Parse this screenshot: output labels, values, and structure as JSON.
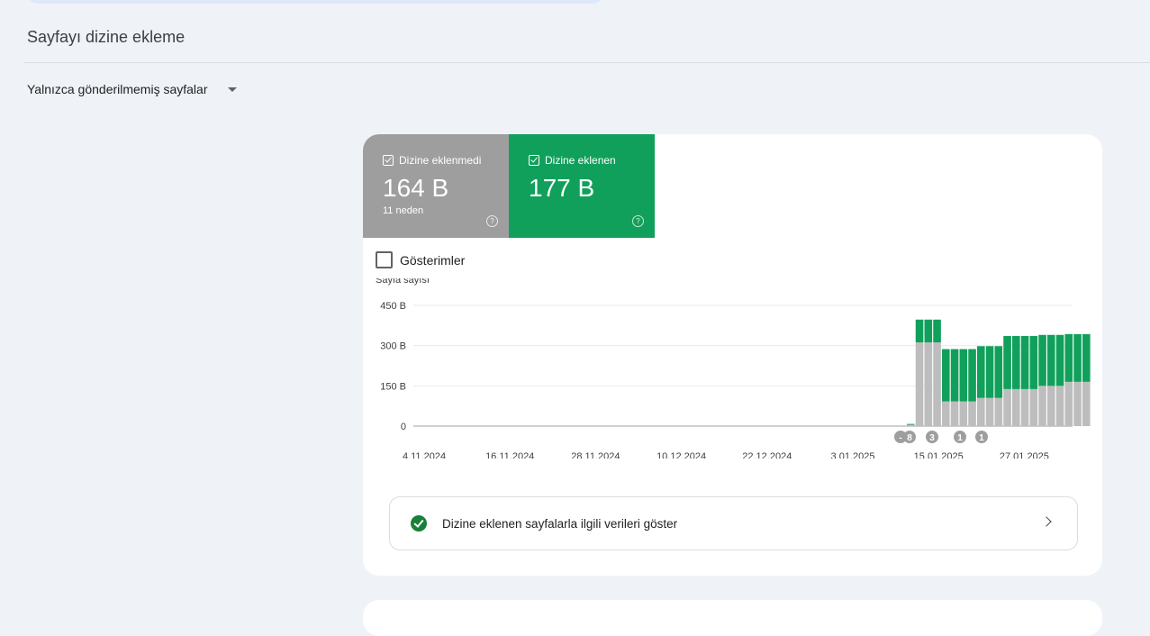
{
  "page": {
    "title": "Sayfayı dizine ekleme"
  },
  "filter": {
    "label": "Yalnızca gönderilmemiş sayfalar"
  },
  "tiles": {
    "not_indexed": {
      "label": "Dizine eklenmedi",
      "value": "164 B",
      "sub": "11 neden",
      "color": "#9e9e9e"
    },
    "indexed": {
      "label": "Dizine eklenen",
      "value": "177 B",
      "color": "#11a05b"
    }
  },
  "impressions": {
    "label": "Gösterimler",
    "checked": false
  },
  "chart_data": {
    "type": "bar",
    "stacked": true,
    "ylabel": "Sayfa sayısı",
    "yticks": [
      "450 B",
      "300 B",
      "150 B",
      "0"
    ],
    "ylim": [
      0,
      450
    ],
    "x_tick_labels": [
      "4.11.2024",
      "16.11.2024",
      "28.11.2024",
      "10.12.2024",
      "22.12.2024",
      "3.01.2025",
      "15.01.2025",
      "27.01.2025"
    ],
    "series": [
      {
        "color": "#bdbdbd",
        "values": [
          5,
          312,
          312,
          312,
          92,
          92,
          92,
          92,
          105,
          105,
          105,
          138,
          138,
          138,
          138,
          150,
          150,
          150,
          165,
          165,
          165
        ]
      },
      {
        "color": "#11a05b",
        "values": [
          3,
          85,
          85,
          85,
          195,
          195,
          195,
          195,
          193,
          193,
          193,
          198,
          198,
          198,
          198,
          190,
          190,
          190,
          178,
          178,
          178
        ]
      }
    ],
    "annotations": [
      "-",
      "8",
      "3",
      "1",
      "1"
    ]
  },
  "action": {
    "label": "Dizine eklenen sayfalarla ilgili verileri göster"
  }
}
